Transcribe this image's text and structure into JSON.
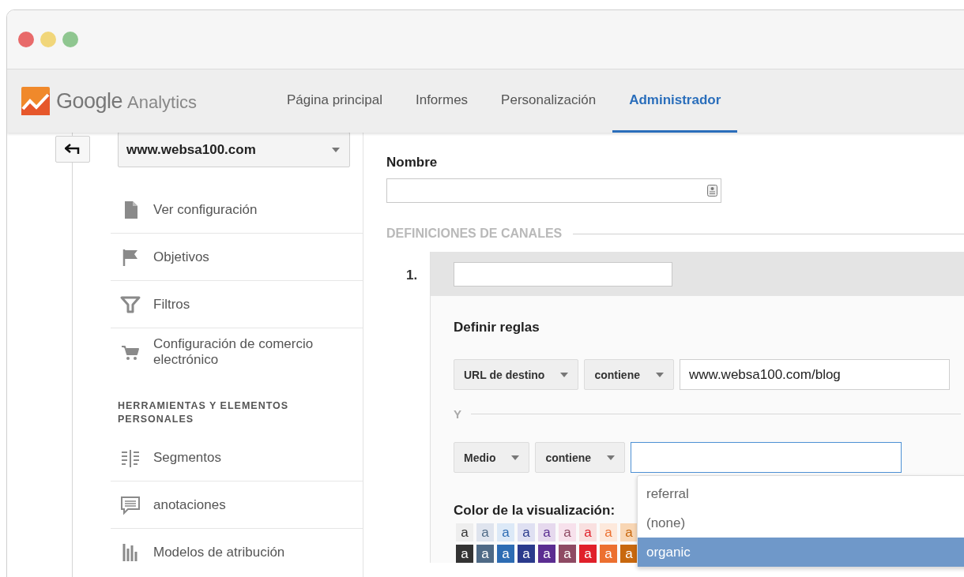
{
  "window": {
    "controls": [
      {
        "color": "#e86a6a"
      },
      {
        "color": "#f1d67a"
      },
      {
        "color": "#8fc690"
      }
    ]
  },
  "header": {
    "logo_word_1": "Google",
    "logo_word_2": "Analytics",
    "nav": [
      {
        "label": "Página principal",
        "selected": false
      },
      {
        "label": "Informes",
        "selected": false
      },
      {
        "label": "Personalización",
        "selected": false
      },
      {
        "label": "Administrador",
        "selected": true
      }
    ]
  },
  "sidebar": {
    "account_selector": "www.websa100.com",
    "items": [
      {
        "label": "Ver configuración",
        "kind": "document"
      },
      {
        "label": "Objetivos",
        "kind": "flag"
      },
      {
        "label": "Filtros",
        "kind": "funnel"
      },
      {
        "label": "Configuración de comercio electrónico",
        "kind": "cart"
      }
    ],
    "section_heading": "HERRAMIENTAS Y ELEMENTOS PERSONALES",
    "tools": [
      {
        "label": "Segmentos",
        "kind": "segments"
      },
      {
        "label": "anotaciones",
        "kind": "comment"
      },
      {
        "label": "Modelos de atribución",
        "kind": "chart"
      }
    ]
  },
  "main": {
    "name_label": "Nombre",
    "section_title": "DEFINICIONES DE CANALES",
    "channel": {
      "number": "1.",
      "rules_title": "Definir reglas",
      "rules": [
        {
          "dimension": "URL de destino",
          "operator": "contiene",
          "value": "www.websa100.com/blog",
          "focused": false
        },
        {
          "dimension": "Medio",
          "operator": "contiene",
          "focused": true
        }
      ],
      "joiner": "Y",
      "color_label": "Color de la visualización:",
      "swatches": [
        {
          "light": {
            "label": "a",
            "color": "#eeeeee"
          },
          "dark": {
            "label": "a",
            "color": "#333333"
          }
        },
        {
          "light": {
            "label": "a",
            "color": "#dfe4ee"
          },
          "dark": {
            "label": "a",
            "color": "#4f6a86"
          }
        },
        {
          "light": {
            "label": "a",
            "color": "#dce9f7"
          },
          "dark": {
            "label": "a",
            "color": "#2d6cb3"
          }
        },
        {
          "light": {
            "label": "a",
            "color": "#dfe0f2"
          },
          "dark": {
            "label": "a",
            "color": "#2a3a8c"
          }
        },
        {
          "light": {
            "label": "a",
            "color": "#e6d9ee"
          },
          "dark": {
            "label": "a",
            "color": "#5b2d91"
          }
        },
        {
          "light": {
            "label": "a",
            "color": "#f7e1ec"
          },
          "dark": {
            "label": "a",
            "color": "#8e4a63"
          }
        },
        {
          "light": {
            "label": "a",
            "color": "#f9e0e0"
          },
          "dark": {
            "label": "a",
            "color": "#e0202a"
          }
        },
        {
          "light": {
            "label": "a",
            "color": "#fde9dc"
          },
          "dark": {
            "label": "a",
            "color": "#ec7030"
          }
        },
        {
          "light": {
            "label": "a",
            "color": "#f8d6b4"
          },
          "dark": {
            "label": "a",
            "color": "#c8680e"
          }
        }
      ],
      "suggestions": [
        {
          "label": "referral",
          "selected": false
        },
        {
          "label": "(none)",
          "selected": false
        },
        {
          "label": "organic",
          "selected": true
        }
      ]
    }
  }
}
